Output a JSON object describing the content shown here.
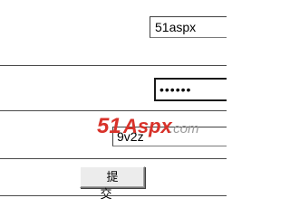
{
  "form": {
    "username": {
      "value": "51aspx"
    },
    "password": {
      "value": "passwd"
    },
    "code": {
      "value": "9v2z"
    },
    "submit_label": "提 交"
  },
  "watermark": {
    "text_main": "51",
    "text_mid": "Aspx",
    "text_suffix": ".com",
    "accent_color": "#d8322a",
    "secondary_color": "#9a9a9a"
  },
  "colors": {
    "background": "#ffffff",
    "divider": "#4a4a4a",
    "button_face": "#ececec"
  }
}
